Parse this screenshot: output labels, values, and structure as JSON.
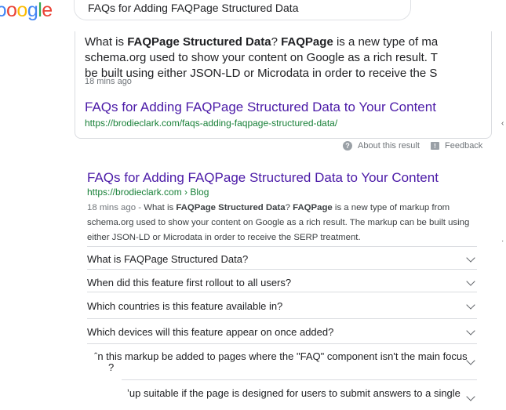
{
  "logo": {
    "letters": [
      "o",
      "o",
      "g",
      "l",
      "e"
    ],
    "prefix": "ɔ"
  },
  "search": {
    "query": "FAQs for Adding FAQPage Structured Data"
  },
  "featured": {
    "snippet_parts": [
      {
        "t": "What is ",
        "b": false
      },
      {
        "t": "FAQPage Structured Data",
        "b": true
      },
      {
        "t": "? ",
        "b": false
      },
      {
        "t": "FAQPage",
        "b": true
      },
      {
        "t": " is a new type of markup fr",
        "b": false
      }
    ],
    "snippet_line2": "schema.org used to show your content on Google as a rich result. The marku",
    "snippet_line3": "be built using either JSON-LD or Microdata in order to receive the SERP treatme",
    "age": "18 mins ago",
    "title": "FAQs for Adding FAQPage Structured Data to Your Content",
    "url": "https://brodieclark.com/faqs-adding-faqpage-structured-data/"
  },
  "meta": {
    "about": "About this result",
    "feedback": "Feedback"
  },
  "result": {
    "title": "FAQs for Adding FAQPage Structured Data to Your Content",
    "url": "https://brodieclark.com › Blog",
    "age_prefix": "18 mins ago - ",
    "line1_a": "What is ",
    "line1_b": "FAQPage Structured Data",
    "line1_c": "? ",
    "line1_d": "FAQPage",
    "line1_e": " is a new type of markup from",
    "line2": "schema.org used to show your content on Google as a rich result. The markup can be built using",
    "line3": "either JSON-LD or Microdata in order to receive the SERP treatment."
  },
  "faqs": [
    "What is FAQPage Structured Data?",
    "When did this feature first rollout to all users?",
    "Which countries is this feature available in?",
    "Which devices will this feature appear on once added?",
    "ˆn this markup be added to pages where the \"FAQ\" component isn't the main focus of the",
    "ʼup suitable if the page is designed for users to submit answers to a single"
  ],
  "faq5_line2": "?"
}
